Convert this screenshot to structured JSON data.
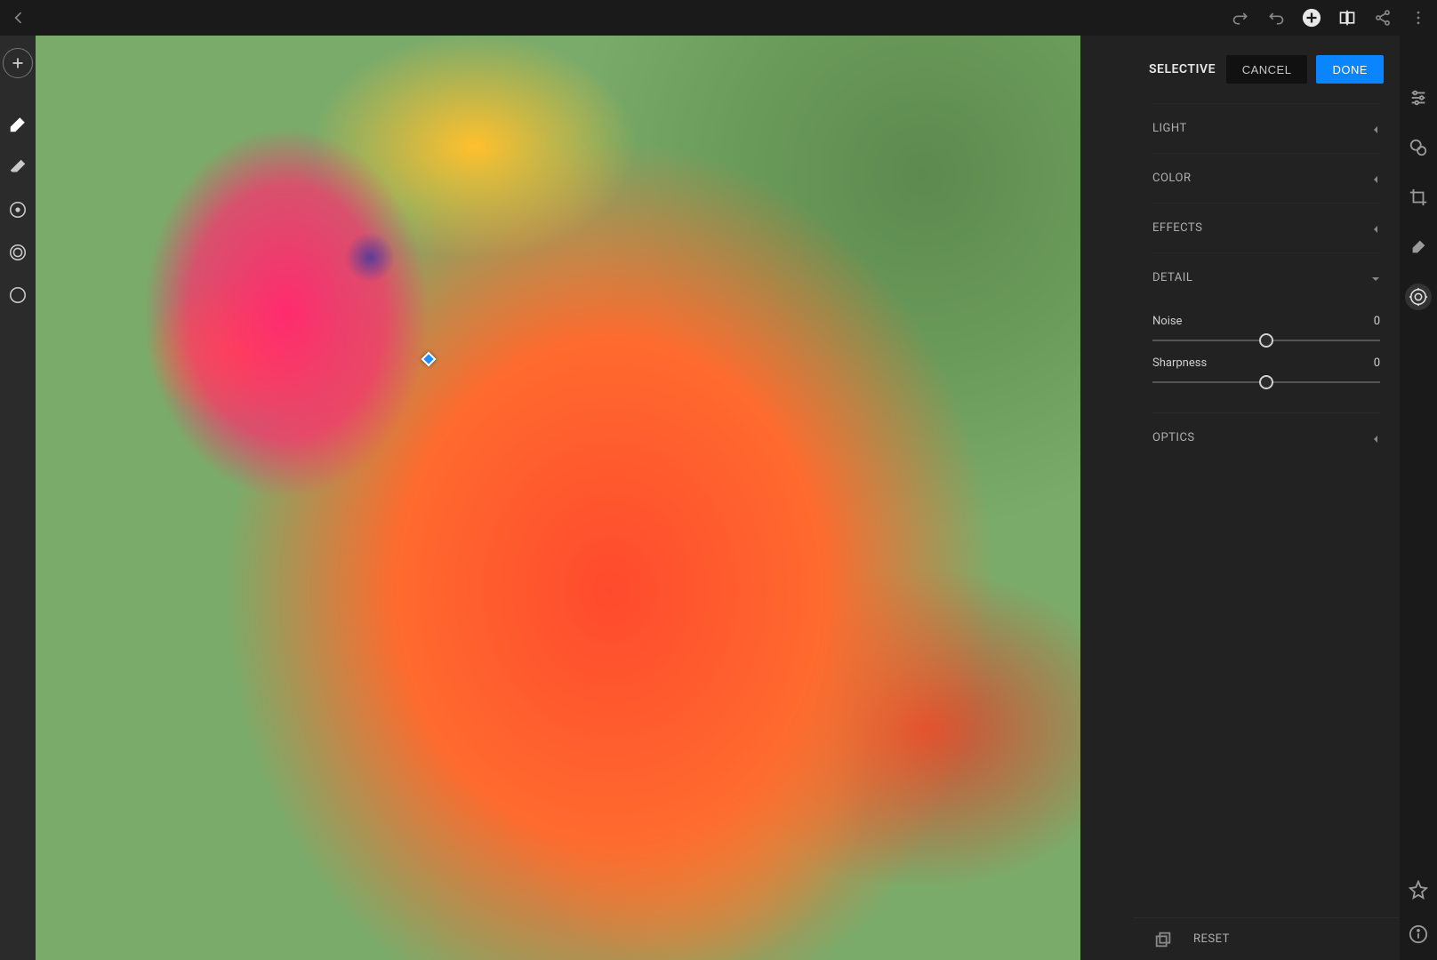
{
  "toolbar": {
    "panel_title": "SELECTIVE",
    "cancel_label": "CANCEL",
    "done_label": "DONE",
    "reset_label": "RESET"
  },
  "sections": {
    "light": {
      "label": "LIGHT",
      "expanded": false
    },
    "color": {
      "label": "COLOR",
      "expanded": false
    },
    "effects": {
      "label": "EFFECTS",
      "expanded": false
    },
    "detail": {
      "label": "DETAIL",
      "expanded": true,
      "sliders": {
        "noise": {
          "label": "Noise",
          "value": "0",
          "min": -100,
          "max": 100,
          "pos_percent": 50
        },
        "sharpness": {
          "label": "Sharpness",
          "value": "0",
          "min": -100,
          "max": 100,
          "pos_percent": 50
        }
      }
    },
    "optics": {
      "label": "OPTICS",
      "expanded": false
    }
  },
  "left_tools": {
    "add": "add-brush",
    "brush": "brush",
    "erase": "eraser",
    "radial": "radial-mask",
    "gradient": "linear-gradient",
    "ellipse": "ellipse-mask"
  },
  "top_icons": {
    "back": "back",
    "redo": "redo",
    "undo": "undo",
    "add": "add-photo",
    "compare": "before-after",
    "share": "share",
    "more": "more"
  },
  "right_icons": {
    "adjust": "adjustments",
    "healing": "healing-brush",
    "crop": "crop",
    "brush": "local-brush",
    "presets": "presets",
    "star": "rating",
    "info": "info"
  },
  "colors": {
    "accent": "#0a84ff"
  }
}
